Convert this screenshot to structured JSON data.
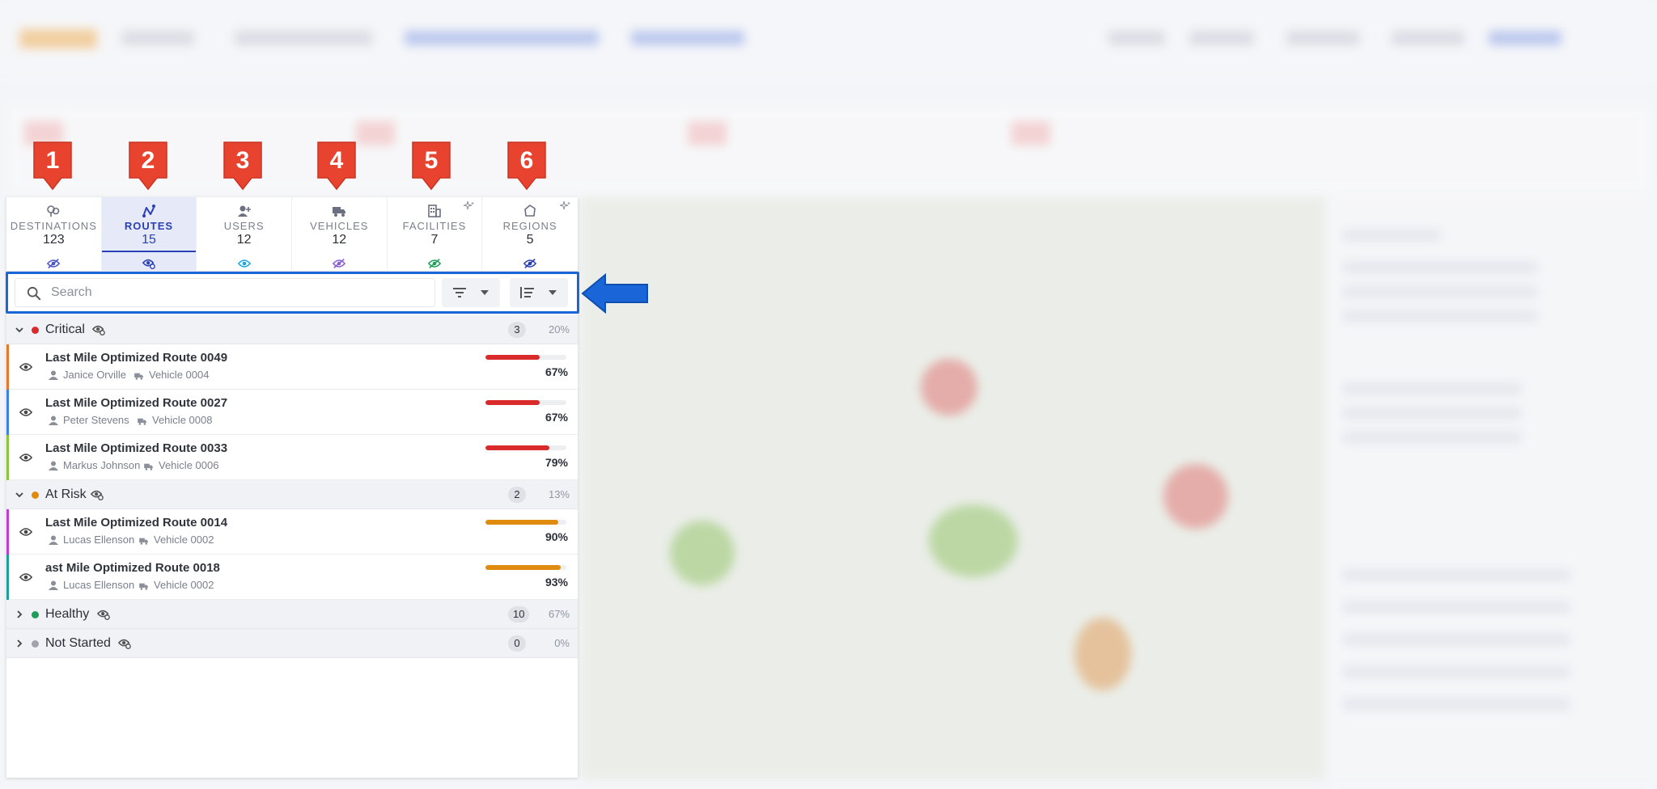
{
  "colors": {
    "accent": "#2a3fb5",
    "highlight_border": "#1a66d8",
    "callout_red": "#e8432f",
    "callout_blue": "#1a66d8",
    "critical": "#d92b2b",
    "at_risk": "#e08a0e",
    "healthy": "#1f9e5a",
    "not_started": "#a0a3ad"
  },
  "tabs": [
    {
      "label": "DESTINATIONS",
      "count": "123",
      "icon": "destinations-icon",
      "visibility": "eye-off-icon",
      "vis_color": "#4a55c4",
      "active": false
    },
    {
      "label": "ROUTES",
      "count": "15",
      "icon": "route-icon",
      "visibility": "eye-settings-icon",
      "vis_color": "#2a3fb5",
      "active": true
    },
    {
      "label": "USERS",
      "count": "12",
      "icon": "users-icon",
      "visibility": "eye-icon",
      "vis_color": "#1aa6e0",
      "active": false
    },
    {
      "label": "VEHICLES",
      "count": "12",
      "icon": "truck-icon",
      "visibility": "eye-off-icon",
      "vis_color": "#8a5cd6",
      "active": false
    },
    {
      "label": "FACILITIES",
      "count": "7",
      "icon": "building-icon",
      "visibility": "eye-off-icon",
      "vis_color": "#1f9e5a",
      "active": false
    },
    {
      "label": "REGIONS",
      "count": "5",
      "icon": "region-icon",
      "visibility": "eye-off-icon",
      "vis_color": "#2a3fb5",
      "active": false
    }
  ],
  "search": {
    "placeholder": "Search"
  },
  "groups": [
    {
      "name": "Critical",
      "count": "3",
      "pct": "20%",
      "dot": "#d92b2b",
      "expanded": true,
      "routes": [
        {
          "title": "Last Mile Optimized Route 0049",
          "user": "Janice Orville",
          "vehicle": "Vehicle 0004",
          "progress": 0.67,
          "pct": "67%",
          "stripe": "#e8772e",
          "bar": "#d92b2b"
        },
        {
          "title": "Last Mile Optimized Route 0027",
          "user": "Peter Stevens",
          "vehicle": "Vehicle 0008",
          "progress": 0.67,
          "pct": "67%",
          "stripe": "#3b82e8",
          "bar": "#d92b2b"
        },
        {
          "title": "Last Mile Optimized Route 0033",
          "user": "Markus Johnson",
          "vehicle": "Vehicle 0006",
          "progress": 0.79,
          "pct": "79%",
          "stripe": "#8cc63f",
          "bar": "#d92b2b"
        }
      ]
    },
    {
      "name": "At Risk",
      "count": "2",
      "pct": "13%",
      "dot": "#e08a0e",
      "expanded": true,
      "routes": [
        {
          "title": "Last Mile Optimized Route 0014",
          "user": "Lucas Ellenson",
          "vehicle": "Vehicle 0002",
          "progress": 0.9,
          "pct": "90%",
          "stripe": "#c23bd6",
          "bar": "#e08a0e"
        },
        {
          "title": "ast Mile Optimized Route 0018",
          "user": "Lucas Ellenson",
          "vehicle": "Vehicle 0002",
          "progress": 0.93,
          "pct": "93%",
          "stripe": "#1f9e9e",
          "bar": "#e08a0e"
        }
      ]
    },
    {
      "name": "Healthy",
      "count": "10",
      "pct": "67%",
      "dot": "#1f9e5a",
      "expanded": false,
      "routes": []
    },
    {
      "name": "Not Started",
      "count": "0",
      "pct": "0%",
      "dot": "#a0a3ad",
      "expanded": false,
      "routes": []
    }
  ],
  "callouts": [
    "1",
    "2",
    "3",
    "4",
    "5",
    "6"
  ]
}
